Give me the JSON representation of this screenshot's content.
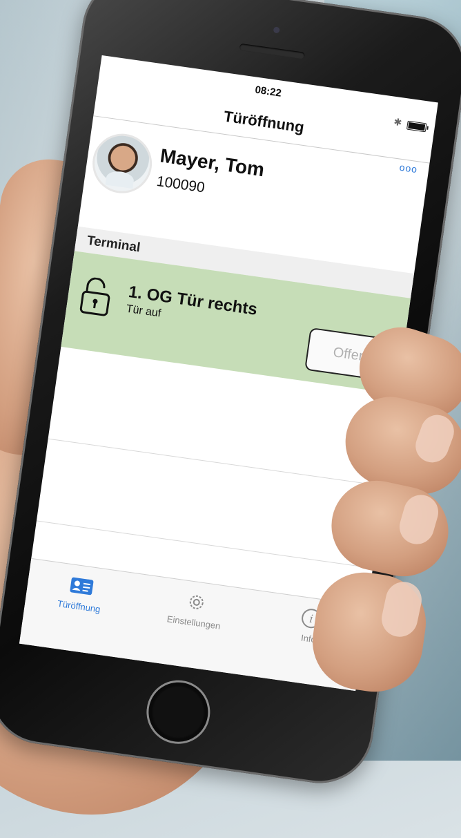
{
  "status_bar": {
    "time": "08:22"
  },
  "nav": {
    "title": "Türöffnung",
    "more_label": "ooo"
  },
  "user": {
    "name": "Mayer, Tom",
    "id": "100090"
  },
  "section": {
    "label": "Terminal"
  },
  "terminals": [
    {
      "name": "1. OG Tür rechts",
      "status": "Tür auf",
      "button_label": "Offen"
    }
  ],
  "tabs": [
    {
      "label": "Türöffnung",
      "icon": "id-card-icon",
      "active": true
    },
    {
      "label": "Einstellungen",
      "icon": "gear-icon",
      "active": false
    },
    {
      "label": "Info",
      "icon": "info-icon",
      "active": false
    }
  ],
  "colors": {
    "accent": "#2f7ad9",
    "terminal_row_bg": "#c6ddb7",
    "section_header_bg": "#efefef"
  }
}
